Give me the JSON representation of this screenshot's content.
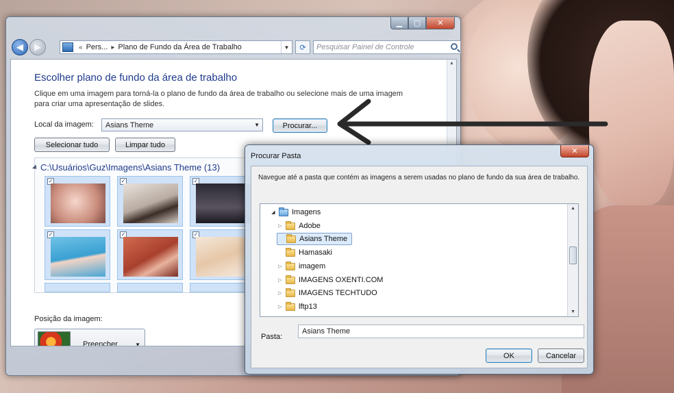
{
  "main_window": {
    "address_crumbs": [
      "Pers...",
      "Plano de Fundo da Área de Trabalho"
    ],
    "search_placeholder": "Pesquisar Painel de Controle",
    "page_title": "Escolher plano de fundo da área de trabalho",
    "page_description": "Clique em uma imagem para torná-la o plano de fundo da área de trabalho ou selecione mais de uma imagem para criar uma apresentação de slides.",
    "location_label": "Local da imagem:",
    "location_value": "Asians Theme",
    "browse_button": "Procurar...",
    "select_all_button": "Selecionar tudo",
    "clear_all_button": "Limpar tudo",
    "folder_path": "C:\\Usuários\\Guz\\Imagens\\Asians Theme (13)",
    "position_label": "Posição da imagem:",
    "position_value": "Preencher"
  },
  "dialog": {
    "title": "Procurar Pasta",
    "description": "Navegue até a pasta que contém as imagens a serem usadas no plano de fundo da sua área de trabalho.",
    "tree_items": [
      {
        "label": "Imagens",
        "expanded": true,
        "level": 0
      },
      {
        "label": "Adobe",
        "expanded": false,
        "level": 1
      },
      {
        "label": "Asians Theme",
        "selected": true,
        "level": 1
      },
      {
        "label": "Hamasaki",
        "level": 1
      },
      {
        "label": "imagem",
        "expanded": false,
        "level": 1
      },
      {
        "label": "IMAGENS OXENTI.COM",
        "expanded": false,
        "level": 1
      },
      {
        "label": "IMAGENS TECHTUDO",
        "expanded": false,
        "level": 1
      },
      {
        "label": "lftp13",
        "expanded": false,
        "level": 1
      }
    ],
    "folder_label": "Pasta:",
    "folder_value": "Asians Theme",
    "ok_button": "OK",
    "cancel_button": "Cancelar"
  },
  "colors": {
    "title_blue": "#1e3a8c",
    "selection_bg": "#dcebfc",
    "thumb_bg": "#cfe2f8",
    "annotation_arrow": "#2a2a2a"
  }
}
